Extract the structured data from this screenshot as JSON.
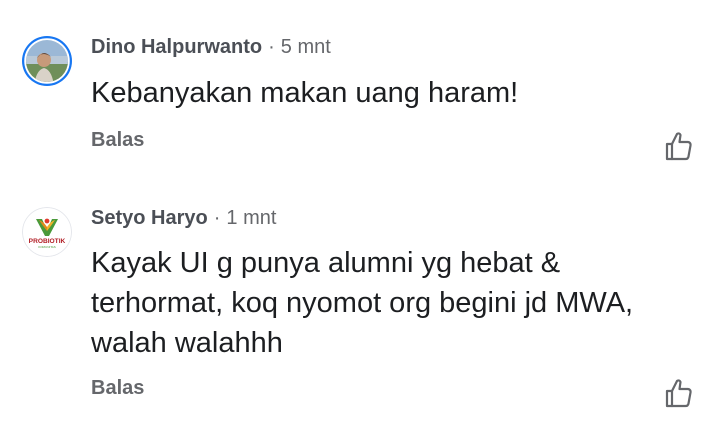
{
  "comments": [
    {
      "author": "Dino Halpurwanto",
      "separator": "·",
      "time": "5 mnt",
      "text": "Kebanyakan makan uang haram!",
      "reply_label": "Balas",
      "avatar_icon": "profile-photo",
      "like_icon": "thumbs-up-icon"
    },
    {
      "author": "Setyo Haryo",
      "separator": "·",
      "time": "1 mnt",
      "text_lines": [
        "Kayak UI g punya alumni yg hebat &",
        "terhormat, koq nyomot org begini jd MWA,",
        "walah walahhh"
      ],
      "reply_label": "Balas",
      "avatar_logo_text": "PROBIOTIK",
      "avatar_logo_subtext": "KOMUNITAS",
      "like_icon": "thumbs-up-icon"
    }
  ],
  "colors": {
    "author": "#4b4f56",
    "meta": "#65676b",
    "body": "#1c1e21",
    "avatar_ring": "#1877f2"
  }
}
